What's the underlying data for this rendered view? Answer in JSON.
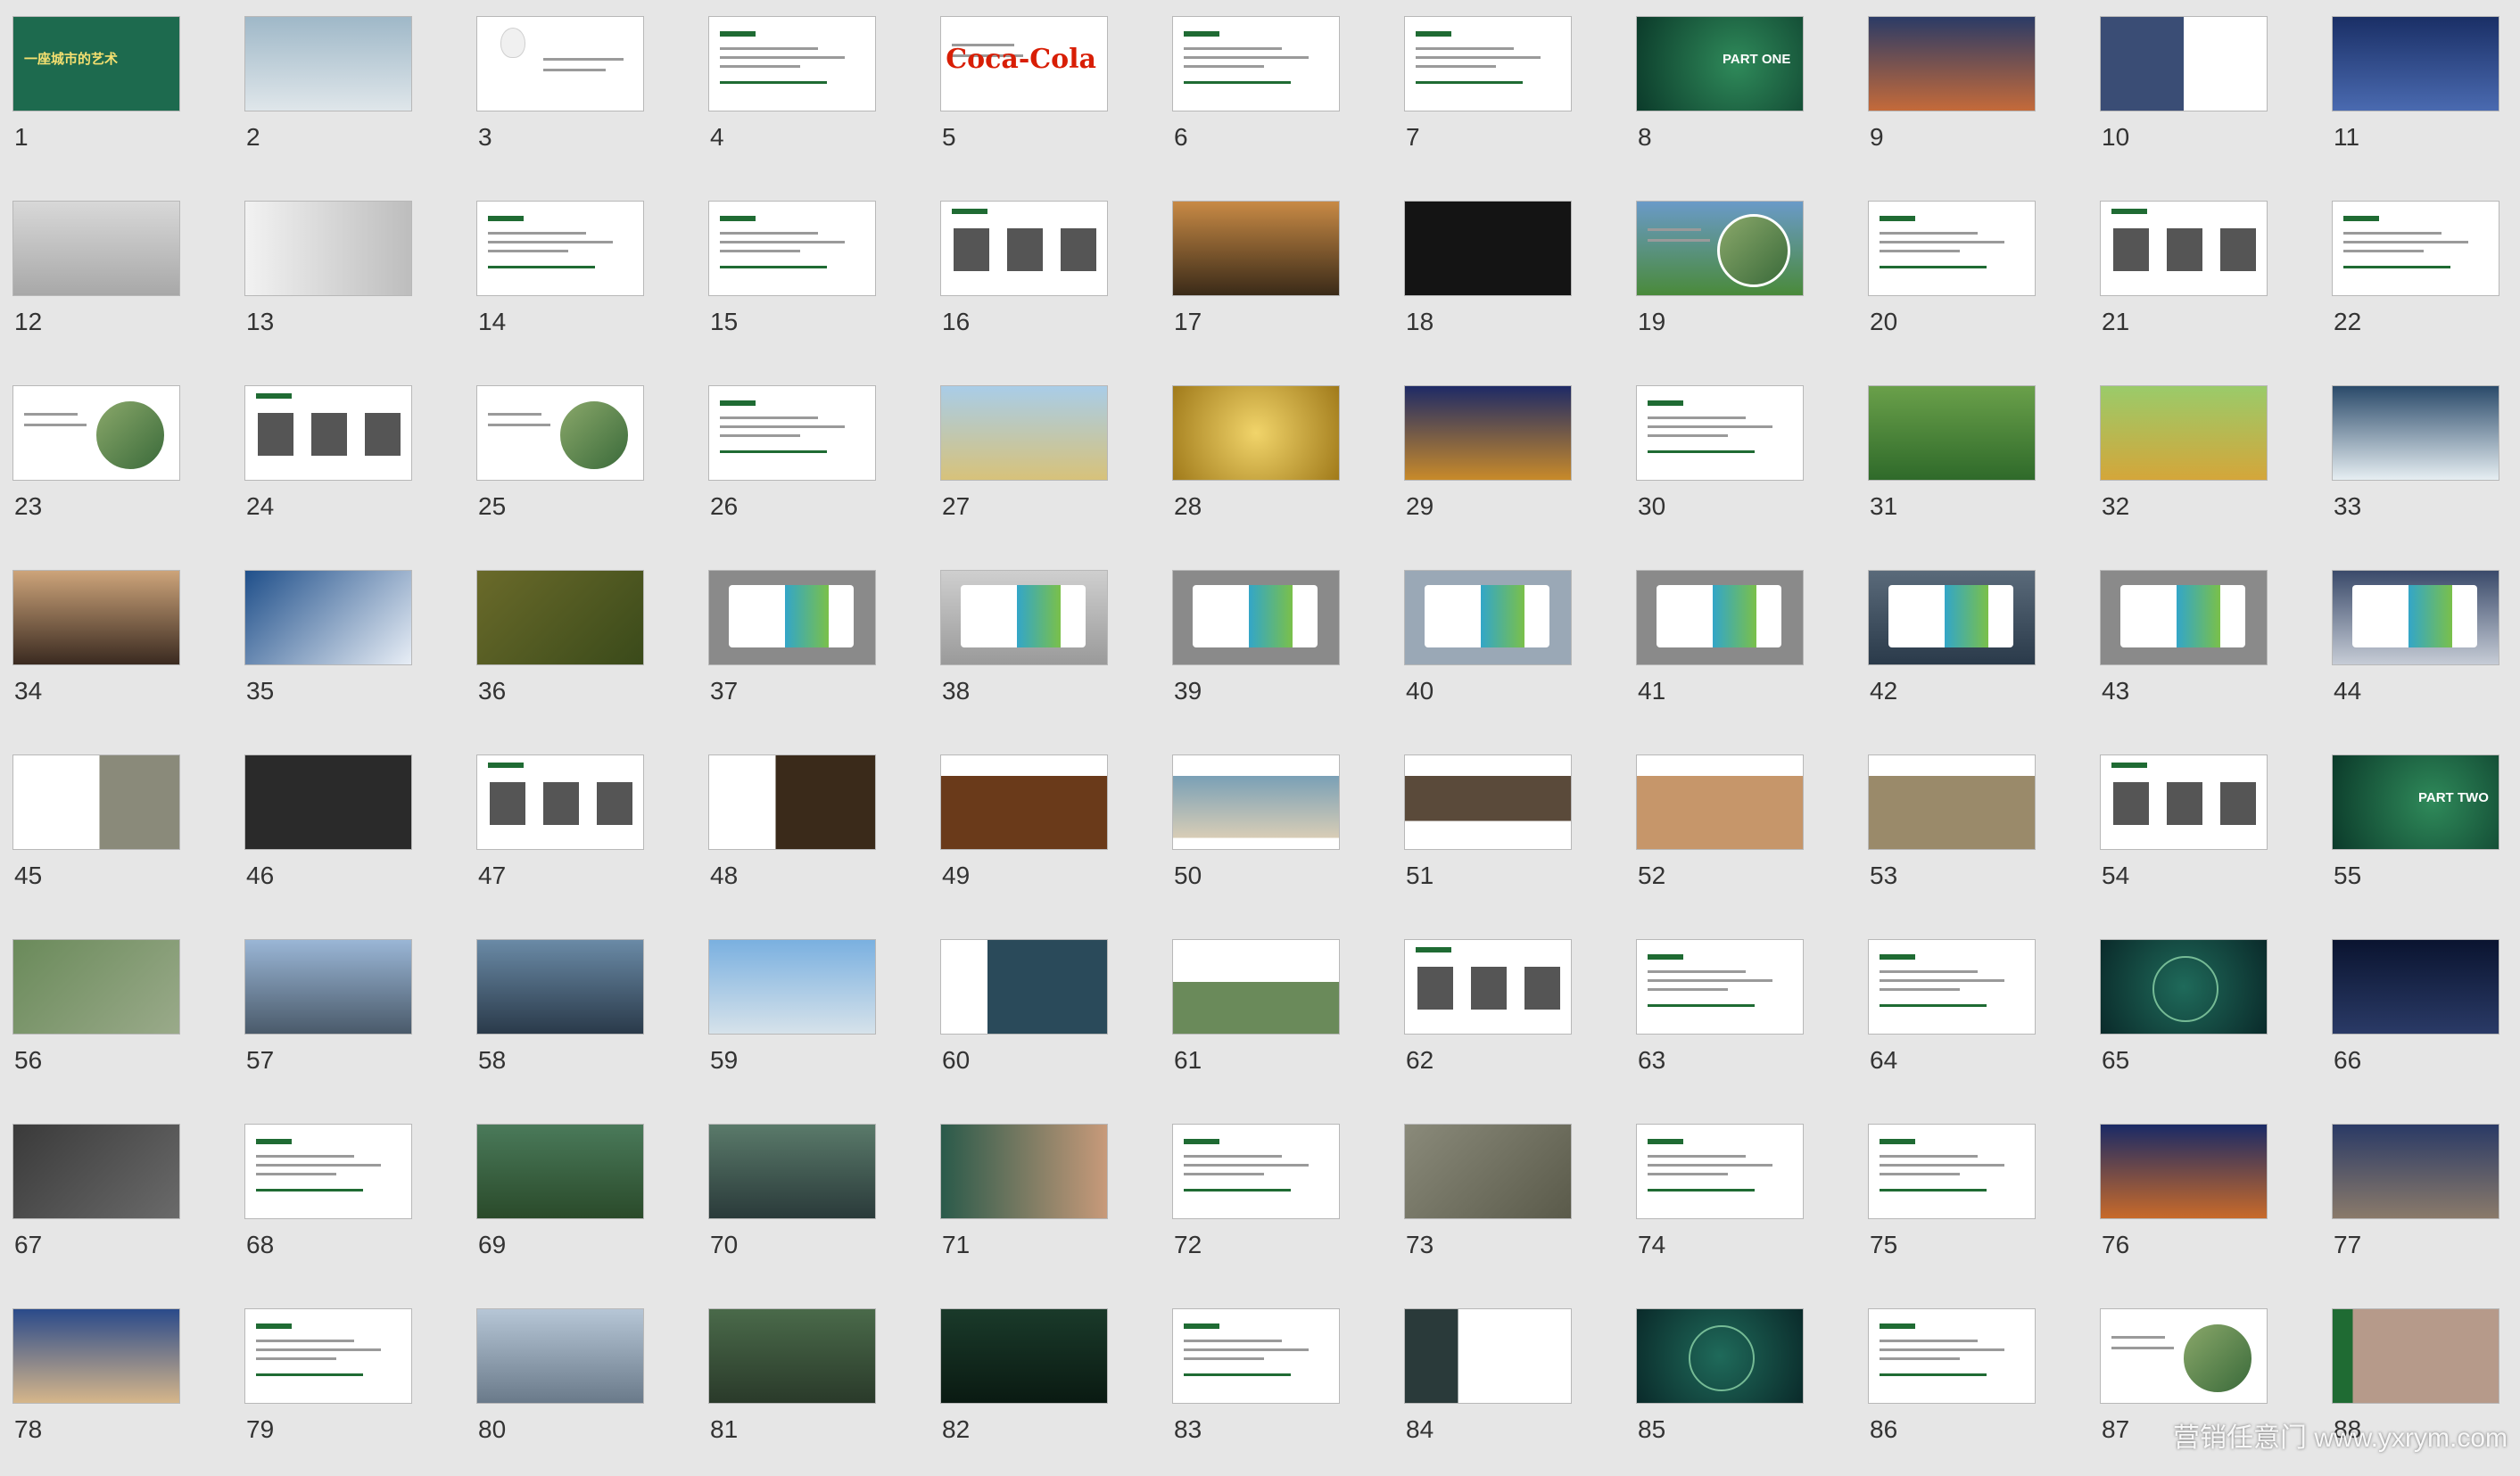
{
  "slides": [
    {
      "number": "1",
      "kind": "cover",
      "bg": "#1d6a4e",
      "text": "一座城市的艺术"
    },
    {
      "number": "2",
      "kind": "photo",
      "bg": "linear-gradient(180deg,#9fb8c8,#dfe6ea)"
    },
    {
      "number": "3",
      "kind": "bulb",
      "bg": "#ffffff"
    },
    {
      "number": "4",
      "kind": "text",
      "bg": "#ffffff"
    },
    {
      "number": "5",
      "kind": "coke",
      "bg": "#ffffff",
      "text": "Coca-Cola"
    },
    {
      "number": "6",
      "kind": "text",
      "bg": "#ffffff"
    },
    {
      "number": "7",
      "kind": "text",
      "bg": "#ffffff"
    },
    {
      "number": "8",
      "kind": "partone",
      "bg": "radial-gradient(circle at 60% 50%,#2f8a5a,#0b3a2a)",
      "text": "PART ONE"
    },
    {
      "number": "9",
      "kind": "photo",
      "bg": "linear-gradient(180deg,#2b3b66,#c46a3a)"
    },
    {
      "number": "10",
      "kind": "split",
      "bg": "linear-gradient(90deg,#3a4d75 50%,#ffffff 50%)"
    },
    {
      "number": "11",
      "kind": "photo",
      "bg": "linear-gradient(180deg,#1a2f66,#4a6ab0)"
    },
    {
      "number": "12",
      "kind": "photo",
      "bg": "linear-gradient(180deg,#d8d8d8,#a8a8a8)"
    },
    {
      "number": "13",
      "kind": "photo",
      "bg": "linear-gradient(90deg,#f2f2f2,#bdbdbd)"
    },
    {
      "number": "14",
      "kind": "text",
      "bg": "#ffffff"
    },
    {
      "number": "15",
      "kind": "text",
      "bg": "#ffffff"
    },
    {
      "number": "16",
      "kind": "people",
      "bg": "#ffffff"
    },
    {
      "number": "17",
      "kind": "photo",
      "bg": "linear-gradient(180deg,#c88a45,#3a2a18)"
    },
    {
      "number": "18",
      "kind": "photo",
      "bg": "#141414"
    },
    {
      "number": "19",
      "kind": "circle",
      "bg": "linear-gradient(180deg,#6a9ac8,#4a8a3a)"
    },
    {
      "number": "20",
      "kind": "text",
      "bg": "#ffffff"
    },
    {
      "number": "21",
      "kind": "people",
      "bg": "#ffffff"
    },
    {
      "number": "22",
      "kind": "text",
      "bg": "#ffffff"
    },
    {
      "number": "23",
      "kind": "circle",
      "bg": "#ffffff"
    },
    {
      "number": "24",
      "kind": "people",
      "bg": "#ffffff"
    },
    {
      "number": "25",
      "kind": "circle",
      "bg": "#ffffff"
    },
    {
      "number": "26",
      "kind": "text",
      "bg": "#ffffff"
    },
    {
      "number": "27",
      "kind": "photo",
      "bg": "linear-gradient(180deg,#a9cde8,#d7c27a)"
    },
    {
      "number": "28",
      "kind": "photo",
      "bg": "radial-gradient(circle,#f1d46a,#a07a1a)"
    },
    {
      "number": "29",
      "kind": "photo",
      "bg": "linear-gradient(180deg,#1e2a66,#c88a2a)"
    },
    {
      "number": "30",
      "kind": "text",
      "bg": "#ffffff"
    },
    {
      "number": "31",
      "kind": "photo",
      "bg": "linear-gradient(180deg,#6aa04a,#2f6a2a)"
    },
    {
      "number": "32",
      "kind": "photo",
      "bg": "linear-gradient(180deg,#9acb6a,#d4a63a)"
    },
    {
      "number": "33",
      "kind": "photo",
      "bg": "linear-gradient(180deg,#2a4a6a,#e6eef2)"
    },
    {
      "number": "34",
      "kind": "photo",
      "bg": "linear-gradient(180deg,#cda47a,#3a2a20)"
    },
    {
      "number": "35",
      "kind": "photo",
      "bg": "linear-gradient(135deg,#1f4f8a,#e8eef6)"
    },
    {
      "number": "36",
      "kind": "photo",
      "bg": "linear-gradient(135deg,#6a6a2a,#3a4a1a)"
    },
    {
      "number": "37",
      "kind": "billboard",
      "bg": "#8a8a8a"
    },
    {
      "number": "38",
      "kind": "billboard",
      "bg": "linear-gradient(180deg,#cfcfcf,#9a9a9a)"
    },
    {
      "number": "39",
      "kind": "billboard",
      "bg": "#8a8a8a"
    },
    {
      "number": "40",
      "kind": "billboard",
      "bg": "#9aa8b6"
    },
    {
      "number": "41",
      "kind": "billboard",
      "bg": "#8a8a8a"
    },
    {
      "number": "42",
      "kind": "billboard",
      "bg": "linear-gradient(180deg,#5a6a7a,#2a3a4a)"
    },
    {
      "number": "43",
      "kind": "billboard",
      "bg": "#8a8a8a"
    },
    {
      "number": "44",
      "kind": "billboard",
      "bg": "linear-gradient(180deg,#3a4a6a,#c6ccd6)"
    },
    {
      "number": "45",
      "kind": "split",
      "bg": "linear-gradient(90deg,#ffffff 52%,#8a8a7a 52%)"
    },
    {
      "number": "46",
      "kind": "photo",
      "bg": "#2a2a2a"
    },
    {
      "number": "47",
      "kind": "people",
      "bg": "#ffffff"
    },
    {
      "number": "48",
      "kind": "split",
      "bg": "linear-gradient(90deg,#ffffff 40%,#3a2a1a 40%)"
    },
    {
      "number": "49",
      "kind": "photo",
      "bg": "linear-gradient(180deg,#ffffff 22%,#6a3a1a 22%)"
    },
    {
      "number": "50",
      "kind": "photo",
      "bg": "linear-gradient(180deg,#ffffff 22%,#7aa0b6 22%,#d8cdb6 88%,#ffffff 88%)"
    },
    {
      "number": "51",
      "kind": "photo",
      "bg": "linear-gradient(180deg,#ffffff 22%,#5a4a3a 22%,#5a4a3a 70%,#ffffff 70%)"
    },
    {
      "number": "52",
      "kind": "photo",
      "bg": "linear-gradient(180deg,#ffffff 22%,#c6966a 22%)"
    },
    {
      "number": "53",
      "kind": "photo",
      "bg": "linear-gradient(180deg,#ffffff 22%,#9a8a6a 22%)"
    },
    {
      "number": "54",
      "kind": "people",
      "bg": "#ffffff"
    },
    {
      "number": "55",
      "kind": "partone",
      "bg": "radial-gradient(circle at 60% 50%,#2f8a5a,#0b3a2a)",
      "text": "PART TWO"
    },
    {
      "number": "56",
      "kind": "photo",
      "bg": "linear-gradient(135deg,#6a8a5a,#9aaa8a)"
    },
    {
      "number": "57",
      "kind": "photo",
      "bg": "linear-gradient(180deg,#9ab6d6,#4a5a6a)"
    },
    {
      "number": "58",
      "kind": "photo",
      "bg": "linear-gradient(180deg,#6a8aa6,#2a3a4a)"
    },
    {
      "number": "59",
      "kind": "photo",
      "bg": "linear-gradient(180deg,#7ab0e0,#d6e2ea)"
    },
    {
      "number": "60",
      "kind": "split",
      "bg": "linear-gradient(90deg,#ffffff 28%,#2a4a5a 28%)"
    },
    {
      "number": "61",
      "kind": "photo",
      "bg": "linear-gradient(180deg,#ffffff 45%,#6a8a5a 45%)"
    },
    {
      "number": "62",
      "kind": "people",
      "bg": "#ffffff"
    },
    {
      "number": "63",
      "kind": "text",
      "bg": "#ffffff"
    },
    {
      "number": "64",
      "kind": "text",
      "bg": "#ffffff"
    },
    {
      "number": "65",
      "kind": "ring",
      "bg": "radial-gradient(circle,#1f6a5a,#0a2a2a)"
    },
    {
      "number": "66",
      "kind": "photo",
      "bg": "linear-gradient(180deg,#0a1430,#2a3a66)"
    },
    {
      "number": "67",
      "kind": "photo",
      "bg": "linear-gradient(135deg,#3a3a3a,#6a6a6a)"
    },
    {
      "number": "68",
      "kind": "text",
      "bg": "#ffffff"
    },
    {
      "number": "69",
      "kind": "photo",
      "bg": "linear-gradient(180deg,#4a7a5a,#2a4a2a)"
    },
    {
      "number": "70",
      "kind": "photo",
      "bg": "linear-gradient(180deg,#5a7a6a,#2a3a3a)"
    },
    {
      "number": "71",
      "kind": "photo",
      "bg": "linear-gradient(90deg,#2a5a4a,#c89a7a)"
    },
    {
      "number": "72",
      "kind": "text",
      "bg": "#ffffff"
    },
    {
      "number": "73",
      "kind": "photo",
      "bg": "linear-gradient(135deg,#8a8a7a,#5a5a4a)"
    },
    {
      "number": "74",
      "kind": "text",
      "bg": "#ffffff"
    },
    {
      "number": "75",
      "kind": "text",
      "bg": "#ffffff"
    },
    {
      "number": "76",
      "kind": "photo",
      "bg": "linear-gradient(180deg,#1a2a66,#c86a2a)"
    },
    {
      "number": "77",
      "kind": "photo",
      "bg": "linear-gradient(180deg,#2a3a66,#8a7a6a)"
    },
    {
      "number": "78",
      "kind": "photo",
      "bg": "linear-gradient(180deg,#2a4a8a,#d6b68a)"
    },
    {
      "number": "79",
      "kind": "text",
      "bg": "#ffffff"
    },
    {
      "number": "80",
      "kind": "photo",
      "bg": "linear-gradient(180deg,#b6c6d6,#6a7a8a)"
    },
    {
      "number": "81",
      "kind": "photo",
      "bg": "linear-gradient(180deg,#4a6a4a,#2a3a2a)"
    },
    {
      "number": "82",
      "kind": "photo",
      "bg": "linear-gradient(180deg,#1a3a2a,#0a1a12)"
    },
    {
      "number": "83",
      "kind": "text",
      "bg": "#ffffff"
    },
    {
      "number": "84",
      "kind": "split",
      "bg": "linear-gradient(90deg,#2a3a3a 32%,#ffffff 32%)"
    },
    {
      "number": "85",
      "kind": "ring",
      "bg": "radial-gradient(circle,#1f6a5a,#0a2a2a)"
    },
    {
      "number": "86",
      "kind": "text",
      "bg": "#ffffff"
    },
    {
      "number": "87",
      "kind": "circle",
      "bg": "#ffffff"
    },
    {
      "number": "88",
      "kind": "photo",
      "bg": "linear-gradient(90deg,#1f6b33 12%,#b69a8a 12%)"
    }
  ],
  "watermark": "营销任意门 www.yxrym.com"
}
